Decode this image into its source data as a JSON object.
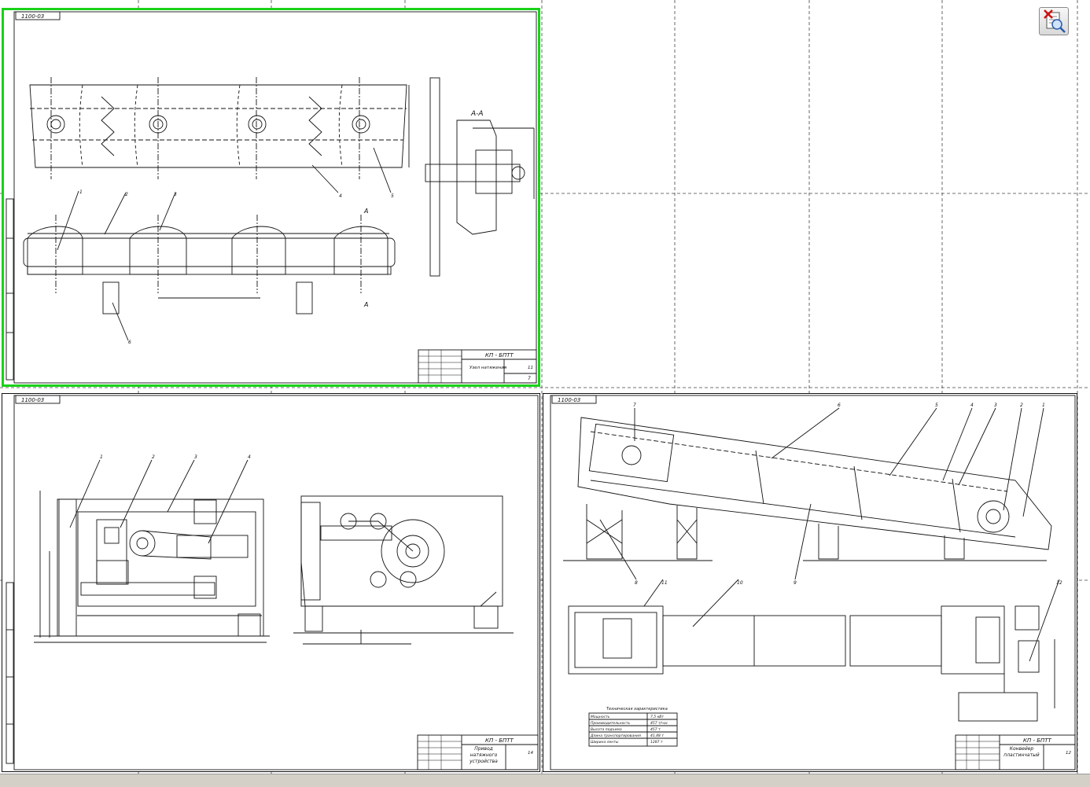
{
  "sheets": [
    {
      "stamp": "1100-03",
      "title_block": {
        "code": "КП - БПТТ",
        "name": "Узел натяжения",
        "sheet": "11"
      },
      "callouts": [
        "1",
        "2",
        "3",
        "4",
        "5",
        "6",
        "7"
      ],
      "section_label": "А-А",
      "section_marks": [
        "А",
        "А"
      ]
    },
    {
      "stamp": "1100-03",
      "title_block": {
        "code": "КП - БПТТ",
        "name": "Привод натяжного устройства",
        "sheet": "14"
      },
      "callouts": [
        "1",
        "2",
        "3",
        "4"
      ]
    },
    {
      "stamp": "1100-03",
      "title_block": {
        "code": "КП - БПТТ",
        "name": "Конвейер пластинчатый",
        "sheet": "12"
      },
      "callouts": [
        "1",
        "2",
        "3",
        "4",
        "5",
        "6",
        "7",
        "8",
        "9",
        "10",
        "11",
        "12"
      ],
      "tech_table": {
        "title": "Техническая характеристика",
        "rows": [
          [
            "Мощность",
            "7,5 кВт"
          ],
          [
            "Производительность",
            "457 т/час"
          ],
          [
            "Высота подъема",
            "457 т"
          ],
          [
            "Длина транспортирования",
            "41,48 т"
          ],
          [
            "Ширина ленты",
            "1287 т"
          ]
        ]
      }
    }
  ],
  "toolbar": {
    "zoom_tooltip_icon": "zoom-close-icon"
  },
  "colors": {
    "selection": "#19d219",
    "grid": "#000000",
    "ui": "#d4d0c8"
  }
}
